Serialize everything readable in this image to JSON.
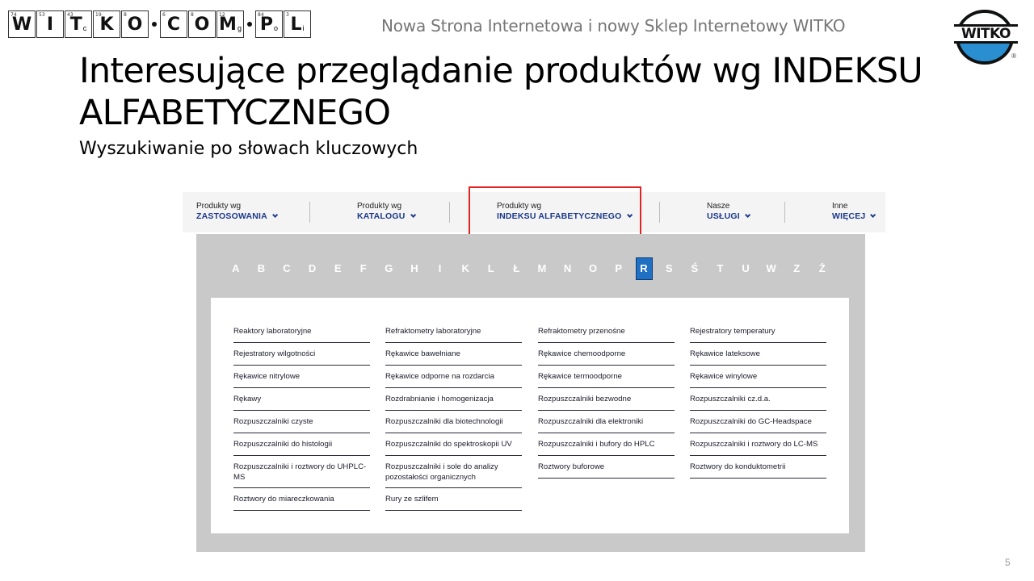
{
  "header": {
    "title": "Nowa Strona Internetowa i nowy Sklep Internetowy WITKO",
    "logo_tiles": [
      {
        "num": "74",
        "sym": "W",
        "sub": ""
      },
      {
        "num": "53",
        "sym": "I",
        "sub": ""
      },
      {
        "num": "43",
        "sym": "T",
        "sub": "c"
      },
      {
        "num": "19",
        "sym": "K",
        "sub": ""
      },
      {
        "num": "8",
        "sym": "O",
        "sub": ""
      },
      {
        "num": "6",
        "sym": "C",
        "sub": ""
      },
      {
        "num": "8",
        "sym": "O",
        "sub": ""
      },
      {
        "num": "12",
        "sym": "M",
        "sub": "g"
      },
      {
        "num": "84",
        "sym": "P",
        "sub": "o"
      },
      {
        "num": "3",
        "sym": "L",
        "sub": "i"
      }
    ],
    "brand_name": "WITKO",
    "brand_reg": "®"
  },
  "slide": {
    "title": "Interesujące przeglądanie produktów wg INDEKSU ALFABETYCZNEGO",
    "subtitle": "Wyszukiwanie po słowach kluczowych",
    "page_number": "5"
  },
  "nav": [
    {
      "small": "Produkty wg",
      "big": "ZASTOSOWANIA"
    },
    {
      "small": "Produkty wg",
      "big": "KATALOGU"
    },
    {
      "small": "Produkty wg",
      "big": "INDEKSU ALFABETYCZNEGO"
    },
    {
      "small": "Nasze",
      "big": "USŁUGI"
    },
    {
      "small": "Inne",
      "big": "WIĘCEJ"
    }
  ],
  "alphabet": [
    "A",
    "B",
    "C",
    "D",
    "E",
    "F",
    "G",
    "H",
    "I",
    "K",
    "L",
    "Ł",
    "M",
    "N",
    "O",
    "P",
    "R",
    "S",
    "Ś",
    "T",
    "U",
    "W",
    "Z",
    "Ż"
  ],
  "active_letter": "R",
  "columns": [
    [
      "Reaktory laboratoryjne",
      "Rejestratory wilgotności",
      "Rękawice nitrylowe",
      "Rękawy",
      "Rozpuszczalniki czyste",
      "Rozpuszczalniki do histologii",
      "Rozpuszczalniki i roztwory do UHPLC-MS",
      "Roztwory do miareczkowania"
    ],
    [
      "Refraktometry laboratoryjne",
      "Rękawice bawełniane",
      "Rękawice odporne na rozdarcia",
      "Rozdrabnianie i homogenizacja",
      "Rozpuszczalniki dla biotechnologii",
      "Rozpuszczalniki do spektroskopii UV",
      "Rozpuszczalniki i sole do analizy pozostałości organicznych",
      "Rury ze szlifem"
    ],
    [
      "Refraktometry przenośne",
      "Rękawice chemoodporne",
      "Rękawice termoodporne",
      "Rozpuszczalniki bezwodne",
      "Rozpuszczalniki dla elektroniki",
      "Rozpuszczalniki i bufory do HPLC",
      "Roztwory buforowe"
    ],
    [
      "Rejestratory temperatury",
      "Rękawice lateksowe",
      "Rękawice winylowe",
      "Rozpuszczalniki cz.d.a.",
      "Rozpuszczalniki do GC-Headspace",
      "Rozpuszczalniki i roztwory do LC-MS",
      "Roztwory do konduktometrii"
    ]
  ],
  "colors": {
    "nav_link": "#1d3a8a",
    "highlight_box": "#e02424",
    "active_letter_bg": "#1f6fc2",
    "panel_gray": "#c9c9c9"
  }
}
